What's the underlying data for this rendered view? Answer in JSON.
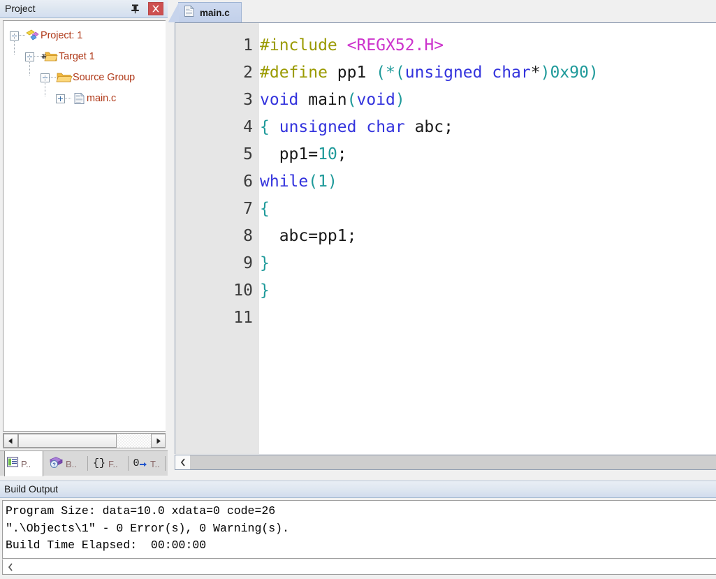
{
  "project_panel": {
    "title": "Project",
    "pin_icon": "pin-icon",
    "close_icon": "close-icon",
    "tree": [
      {
        "label": "Project: 1",
        "icon": "project-icon",
        "expander": "minus",
        "depth": 0
      },
      {
        "label": "Target 1",
        "icon": "target-folder-icon",
        "expander": "minus",
        "depth": 1
      },
      {
        "label": "Source Group",
        "icon": "folder-icon",
        "expander": "minus",
        "depth": 2
      },
      {
        "label": "main.c",
        "icon": "c-file-icon",
        "expander": "plus",
        "depth": 3
      }
    ],
    "tabs": [
      {
        "label": "P..",
        "icon": "project-window-icon",
        "active": true
      },
      {
        "label": "B..",
        "icon": "books-icon",
        "active": false
      },
      {
        "label": "F..",
        "icon": "functions-braces-icon",
        "active": false
      },
      {
        "label": "T..",
        "icon": "templates-icon",
        "active": false
      }
    ],
    "scroll_left_icon": "scroll-left-arrow-icon",
    "scroll_right_icon": "scroll-right-arrow-icon"
  },
  "editor": {
    "tab": {
      "label": "main.c",
      "icon": "c-file-icon"
    },
    "lines": [
      {
        "no": "1",
        "tokens": [
          {
            "t": "#include ",
            "c": "pre"
          },
          {
            "t": "<REGX52.H>",
            "c": "inc"
          }
        ]
      },
      {
        "no": "2",
        "tokens": [
          {
            "t": "#define ",
            "c": "pre"
          },
          {
            "t": "pp1 ",
            "c": "plain"
          },
          {
            "t": "(*(",
            "c": "brace"
          },
          {
            "t": "unsigned char",
            "c": "kw"
          },
          {
            "t": "*",
            "c": "plain"
          },
          {
            "t": ")",
            "c": "brace"
          },
          {
            "t": "0x90",
            "c": "num"
          },
          {
            "t": ")",
            "c": "brace"
          }
        ]
      },
      {
        "no": "3",
        "tokens": [
          {
            "t": "void",
            "c": "kw"
          },
          {
            "t": " main",
            "c": "plain"
          },
          {
            "t": "(",
            "c": "brace"
          },
          {
            "t": "void",
            "c": "kw"
          },
          {
            "t": ")",
            "c": "brace"
          }
        ]
      },
      {
        "no": "4",
        "tokens": [
          {
            "t": "{",
            "c": "brace"
          },
          {
            "t": " ",
            "c": "plain"
          },
          {
            "t": "unsigned char",
            "c": "kw"
          },
          {
            "t": " abc;",
            "c": "plain"
          }
        ]
      },
      {
        "no": "5",
        "tokens": [
          {
            "t": "  pp1=",
            "c": "plain"
          },
          {
            "t": "10",
            "c": "num"
          },
          {
            "t": ";",
            "c": "plain"
          }
        ]
      },
      {
        "no": "6",
        "tokens": [
          {
            "t": "while",
            "c": "kw"
          },
          {
            "t": "(",
            "c": "brace"
          },
          {
            "t": "1",
            "c": "num"
          },
          {
            "t": ")",
            "c": "brace"
          }
        ]
      },
      {
        "no": "7",
        "tokens": [
          {
            "t": "{",
            "c": "brace"
          }
        ]
      },
      {
        "no": "8",
        "tokens": [
          {
            "t": "  abc=pp1;",
            "c": "plain"
          }
        ]
      },
      {
        "no": "9",
        "tokens": [
          {
            "t": "}",
            "c": "brace"
          }
        ]
      },
      {
        "no": "10",
        "tokens": [
          {
            "t": "}",
            "c": "brace"
          }
        ]
      },
      {
        "no": "11",
        "tokens": []
      }
    ],
    "scroll_left_icon": "scroll-left-chevron-icon"
  },
  "build_output": {
    "title": "Build Output",
    "lines": [
      "Program Size: data=10.0 xdata=0 code=26",
      "\".\\Objects\\1\" - 0 Error(s), 0 Warning(s).",
      "Build Time Elapsed:  00:00:00"
    ],
    "scroll_left_icon": "scroll-left-chevron-icon"
  },
  "colors": {
    "preprocessor": "#9a9a00",
    "include_path": "#cc33cc",
    "keyword": "#3333dd",
    "number": "#1f9a9a",
    "brace": "#1f9a9a",
    "plain_text": "#1a1a1a",
    "tree_label": "#b03a1a",
    "close_button": "#cd5050",
    "titlebar": "#dde6f0",
    "gutter": "#e6e6e6"
  }
}
